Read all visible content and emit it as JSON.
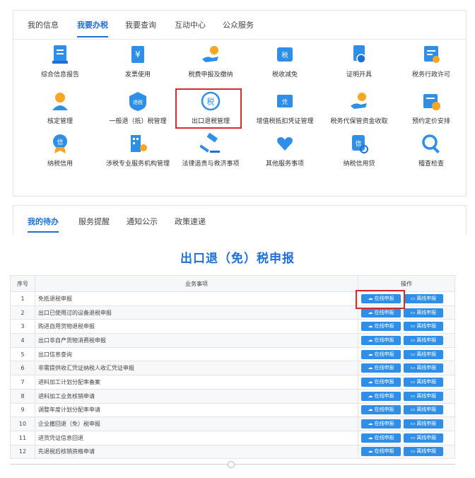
{
  "top_tabs": [
    "我的信息",
    "我要办税",
    "我要查询",
    "互动中心",
    "公众服务"
  ],
  "grid": [
    {
      "label": "综合信息报告",
      "icon": "report-icon"
    },
    {
      "label": "发票使用",
      "icon": "invoice-icon"
    },
    {
      "label": "税费申报及缴纳",
      "icon": "hand-coin-icon"
    },
    {
      "label": "税收减免",
      "icon": "tax-reduction-icon"
    },
    {
      "label": "证明开具",
      "icon": "certificate-icon"
    },
    {
      "label": "税务行政许可",
      "icon": "license-icon"
    },
    {
      "label": "核定管理",
      "icon": "user-approval-icon"
    },
    {
      "label": "一般退（抵）税管理",
      "icon": "refund-badge-icon"
    },
    {
      "label": "出口退税管理",
      "icon": "export-refund-icon"
    },
    {
      "label": "增值税抵扣凭证管理",
      "icon": "voucher-icon"
    },
    {
      "label": "税务代保管资金收取",
      "icon": "fund-custody-icon"
    },
    {
      "label": "预约定价安排",
      "icon": "pricing-arrangement-icon"
    },
    {
      "label": "纳税信用",
      "icon": "credit-medal-icon"
    },
    {
      "label": "涉税专业服务机构管理",
      "icon": "agency-building-icon"
    },
    {
      "label": "法律追责与救济事项",
      "icon": "gavel-icon"
    },
    {
      "label": "其他服务事项",
      "icon": "heart-hands-icon"
    },
    {
      "label": "纳税信用贷",
      "icon": "credit-loan-icon"
    },
    {
      "label": "稽查检查",
      "icon": "magnifier-icon"
    }
  ],
  "second_tabs": [
    "我的待办",
    "服务提醒",
    "通知公示",
    "政策速递"
  ],
  "page_title": "出口退（免）税申报",
  "table": {
    "headers": [
      "序号",
      "业务事项",
      "操作"
    ],
    "online_label": "在线申报",
    "offline_label": "离线申报",
    "rows": [
      {
        "no": "1",
        "item": "免抵退税申报"
      },
      {
        "no": "2",
        "item": "出口已使用过的设备退税申报"
      },
      {
        "no": "3",
        "item": "购进自用货物退税申报"
      },
      {
        "no": "4",
        "item": "出口非自产货物消费税申报"
      },
      {
        "no": "5",
        "item": "出口信息查询"
      },
      {
        "no": "6",
        "item": "非需提供收汇凭证纳税人收汇凭证申报"
      },
      {
        "no": "7",
        "item": "进料加工计划分配率备案"
      },
      {
        "no": "8",
        "item": "进料加工业务核销申请"
      },
      {
        "no": "9",
        "item": "调整年度计划分配率申请"
      },
      {
        "no": "10",
        "item": "企业撤回退（免）税申报"
      },
      {
        "no": "11",
        "item": "进货凭证信息回退"
      },
      {
        "no": "12",
        "item": "先退税后核销资格申请"
      }
    ]
  },
  "colors": {
    "accent": "#1f6fd6",
    "highlight": "#d9282f",
    "button": "#2f8ee7"
  }
}
